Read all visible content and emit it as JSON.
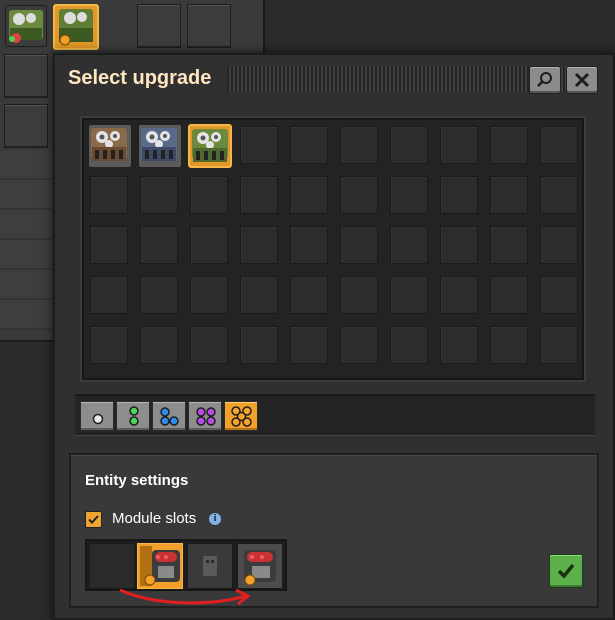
{
  "window": {
    "title": "Select upgrade"
  },
  "icons": {
    "search": "search-icon",
    "close": "close-icon",
    "info": "info-icon",
    "confirm": "checkmark-icon",
    "checkbox": "checkbox-checked-icon"
  },
  "upgrade_grid": {
    "rows": 5,
    "columns": 10,
    "items": [
      {
        "name": "assembling-machine-1",
        "selected": false
      },
      {
        "name": "assembling-machine-2",
        "selected": false
      },
      {
        "name": "assembling-machine-3",
        "selected": true
      }
    ]
  },
  "quality_tiers": [
    {
      "name": "normal",
      "color": "#e8e8e8",
      "selected": false
    },
    {
      "name": "uncommon",
      "color": "#4ad45a",
      "selected": false
    },
    {
      "name": "rare",
      "color": "#2f8df0",
      "selected": false
    },
    {
      "name": "epic",
      "color": "#b84ae6",
      "selected": false
    },
    {
      "name": "legendary",
      "color": "#f2a12a",
      "selected": true
    }
  ],
  "entity_settings": {
    "title": "Entity settings",
    "module_slots_label": "Module slots",
    "module_slots_checked": true,
    "info_glyph": "i",
    "slots": [
      {
        "kind": "empty"
      },
      {
        "kind": "module",
        "name": "speed-module",
        "quality": "legendary"
      },
      {
        "kind": "module",
        "name": "speed-module",
        "quality": "legendary"
      }
    ]
  },
  "colors": {
    "accent": "#e39827",
    "title_text": "#ffe6c0",
    "confirm": "#5db14a",
    "arrow": "#e02020"
  }
}
